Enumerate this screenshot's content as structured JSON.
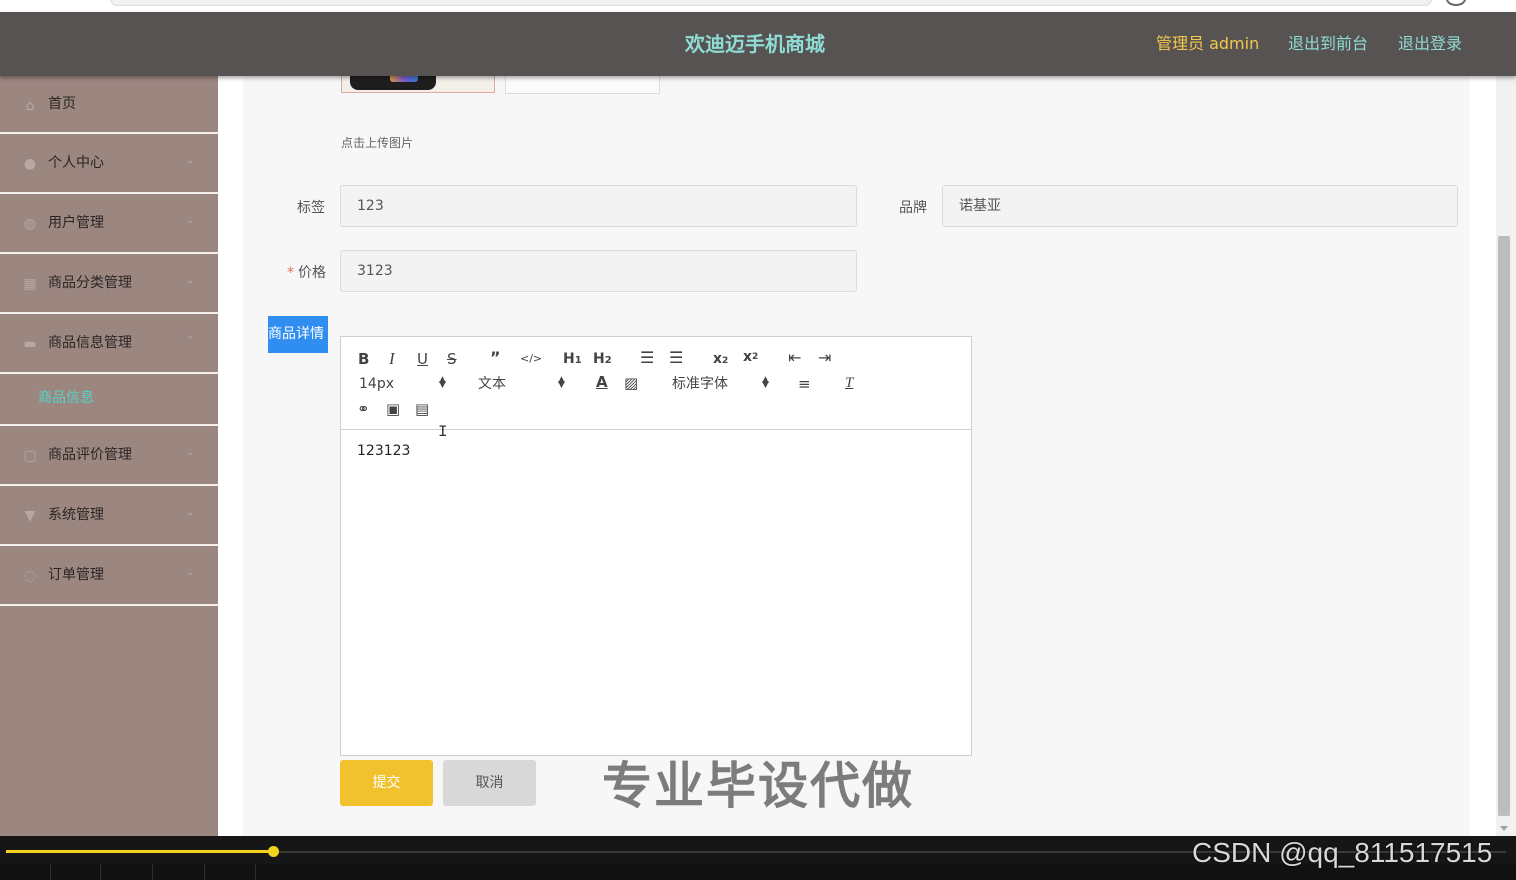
{
  "header": {
    "title": "欢迪迈手机商城",
    "admin_label": "管理员 admin",
    "to_front": "退出到前台",
    "logout": "退出登录"
  },
  "sidebar": {
    "items": [
      {
        "label": "首页",
        "icon": "home-icon"
      },
      {
        "label": "个人中心",
        "icon": "user-icon"
      },
      {
        "label": "用户管理",
        "icon": "users-icon"
      },
      {
        "label": "商品分类管理",
        "icon": "grid-icon"
      },
      {
        "label": "商品信息管理",
        "icon": "briefcase-icon",
        "expanded": true
      },
      {
        "label": "商品评价管理",
        "icon": "comment-icon"
      },
      {
        "label": "系统管理",
        "icon": "settings-icon"
      },
      {
        "label": "订单管理",
        "icon": "power-icon"
      }
    ],
    "sub_item": "商品信息"
  },
  "form": {
    "upload_hint": "点击上传图片",
    "tag_label": "标签",
    "tag_value": "123",
    "brand_label": "品牌",
    "brand_value": "诺基亚",
    "price_required": "*",
    "price_label": "价格",
    "price_value": "3123",
    "detail_label": "商品详情"
  },
  "editor": {
    "font_size": "14px",
    "header_select": "文本",
    "font_family": "标准字体",
    "content": "123123"
  },
  "buttons": {
    "submit": "提交",
    "cancel": "取消"
  },
  "overlays": {
    "watermark_center": "专业毕设代做",
    "watermark_corner": "CSDN @qq_811517515"
  },
  "player": {
    "progress_fraction": 0.178
  },
  "colors": {
    "header_bg": "#565352",
    "title": "#8fdcd4",
    "admin": "#f3c94b",
    "sidebar_bg": "#9c8680",
    "active_sub": "#54d3c9",
    "submit": "#f2c12e",
    "detail_label": "#2f8ef0"
  }
}
